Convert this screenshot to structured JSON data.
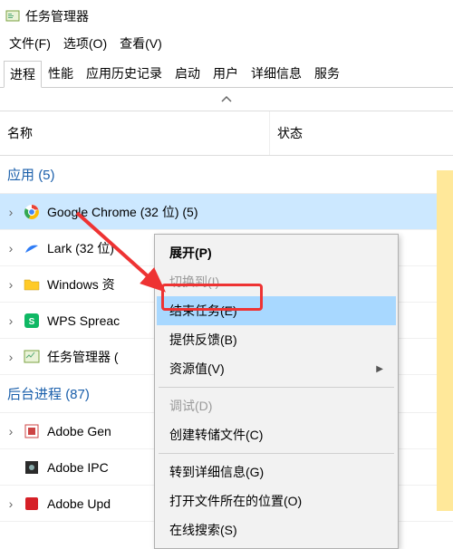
{
  "window": {
    "title": "任务管理器"
  },
  "menubar": {
    "file": "文件(F)",
    "options": "选项(O)",
    "view": "查看(V)"
  },
  "tabs": {
    "processes": "进程",
    "performance": "性能",
    "history": "应用历史记录",
    "startup": "启动",
    "users": "用户",
    "details": "详细信息",
    "services": "服务"
  },
  "columns": {
    "name": "名称",
    "status": "状态"
  },
  "sections": {
    "apps": {
      "label": "应用",
      "count": "(5)"
    },
    "background": {
      "label": "后台进程",
      "count": "(87)"
    }
  },
  "rows": {
    "chrome": "Google Chrome (32 位) (5)",
    "lark": "Lark (32 位)",
    "explorer": "Windows 资",
    "wps": "WPS Spreac",
    "taskmgr": "任务管理器 (",
    "adobe_gen": "Adobe Gen",
    "adobe_ipc": "Adobe IPC",
    "adobe_upd": "Adobe Upd"
  },
  "context_menu": {
    "expand": "展开(P)",
    "switch_to": "切换到(I)",
    "end_task": "结束任务(E)",
    "feedback": "提供反馈(B)",
    "resource": "资源值(V)",
    "debug": "调试(D)",
    "dump": "创建转储文件(C)",
    "goto_details": "转到详细信息(G)",
    "open_location": "打开文件所在的位置(O)",
    "search_online": "在线搜索(S)"
  }
}
